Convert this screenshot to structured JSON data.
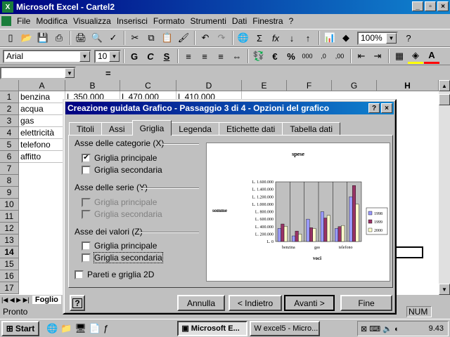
{
  "window": {
    "title": "Microsoft Excel - Cartel2"
  },
  "menu": [
    "File",
    "Modifica",
    "Visualizza",
    "Inserisci",
    "Formato",
    "Strumenti",
    "Dati",
    "Finestra",
    "?"
  ],
  "toolbar": {
    "zoom": "100%",
    "font": "Arial",
    "font_size": "10",
    "currency_symbol": "€",
    "percent": "%",
    "bold": "G",
    "italic": "C",
    "underline": "S",
    "help": "?"
  },
  "formula": {
    "equals": "="
  },
  "columns": [
    "A",
    "B",
    "C",
    "D",
    "E",
    "F",
    "G",
    "H"
  ],
  "rows": [
    "1",
    "2",
    "3",
    "4",
    "5",
    "6",
    "7",
    "8",
    "9",
    "10",
    "11",
    "12",
    "13",
    "14",
    "15",
    "16",
    "17"
  ],
  "cells": {
    "a1": "benzina",
    "a2": "acqua",
    "a3": "gas",
    "a4": "elettricità",
    "a5": "telefono",
    "a6": "affitto",
    "b1": "L 350.000",
    "c1": "L 470.000",
    "d1": "L 410.000"
  },
  "sheet_tab": "Foglio",
  "status": {
    "ready": "Pronto",
    "num": "NUM"
  },
  "taskbar": {
    "start": "Start",
    "task1": "Microsoft E...",
    "task2": "excel5 - Micro...",
    "clock": "9.43"
  },
  "dialog": {
    "title": "Creazione guidata Grafico - Passaggio 3 di 4 - Opzioni del grafico",
    "tabs": [
      "Titoli",
      "Assi",
      "Griglia",
      "Legenda",
      "Etichette dati",
      "Tabella dati"
    ],
    "active_tab": "Griglia",
    "groups": {
      "x": {
        "label": "Asse delle categorie (X)",
        "major": "Griglia principale",
        "major_checked": true,
        "minor": "Griglia secondaria",
        "minor_checked": false
      },
      "series": {
        "label": "Asse delle serie (Y)",
        "major": "Griglia principale",
        "minor": "Griglia secondaria"
      },
      "values": {
        "label": "Asse dei valori (Z)",
        "major": "Griglia principale",
        "major_checked": false,
        "minor": "Griglia secondaria",
        "minor_checked": false
      }
    },
    "walls": "Pareti e griglia 2D",
    "buttons": {
      "help": "?",
      "cancel": "Annulla",
      "back": "< Indietro",
      "next": "Avanti >",
      "finish": "Fine"
    }
  },
  "chart_data": {
    "type": "bar",
    "title": "spese",
    "ylabel": "somme",
    "xlabel": "voci",
    "categories": [
      "benzina",
      "acqua",
      "gas",
      "elettricità",
      "telefono",
      "affitto"
    ],
    "x_tick_labels": [
      "benzina",
      "gas",
      "telefono"
    ],
    "y_ticks": [
      "L. 1.600.000",
      "L. 1.400.000",
      "L. 1.200.000",
      "L. 1.000.000",
      "L. 800.000",
      "L. 600.000",
      "L. 400.000",
      "L. 200.000",
      "L. 0"
    ],
    "ylim": [
      0,
      1600000
    ],
    "series": [
      {
        "name": "1998",
        "color": "#9999ff",
        "values": [
          350000,
          150000,
          600000,
          800000,
          350000,
          1200000
        ]
      },
      {
        "name": "1999",
        "color": "#993366",
        "values": [
          470000,
          280000,
          370000,
          630000,
          400000,
          1500000
        ]
      },
      {
        "name": "2000",
        "color": "#ffffcc",
        "values": [
          410000,
          200000,
          350000,
          700000,
          430000,
          1000000
        ]
      }
    ],
    "legend": "right"
  }
}
